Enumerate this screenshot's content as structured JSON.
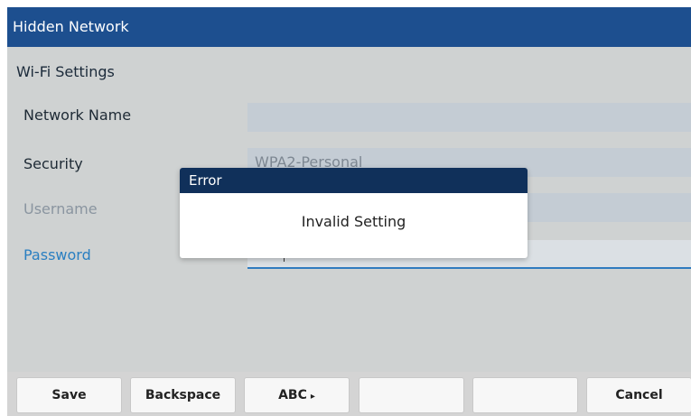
{
  "window": {
    "title": "Hidden Network"
  },
  "section": {
    "title": "Wi-Fi Settings"
  },
  "form": {
    "network_name": {
      "label": "Network Name",
      "value": ""
    },
    "security": {
      "label": "Security",
      "value": "WPA2-Personal"
    },
    "username": {
      "label": "Username",
      "value": ""
    },
    "password": {
      "label": "Password",
      "value": ""
    }
  },
  "dialog": {
    "title": "Error",
    "message": "Invalid Setting"
  },
  "softkeys": {
    "save": "Save",
    "backspace": "Backspace",
    "abc": "ABC",
    "abc_arrow": "▸",
    "empty1": "",
    "empty2": "",
    "cancel": "Cancel"
  },
  "colors": {
    "title_bar": "#1d4f8f",
    "dialog_header": "#10305a",
    "focus_accent": "#2f7bbf",
    "background": "#cfd2d2"
  }
}
